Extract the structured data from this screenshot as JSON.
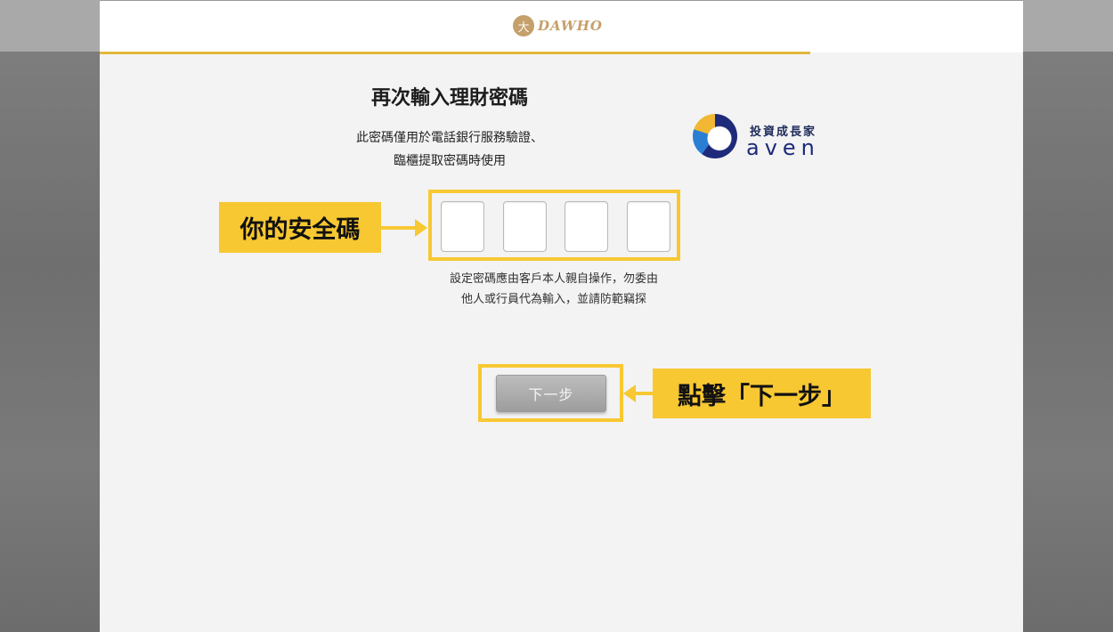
{
  "header": {
    "logo_mark": "大",
    "logo_text": "DAWHO"
  },
  "title": "再次輸入理財密碼",
  "subtitle": [
    "此密碼僅用於電話銀行服務驗證、",
    "臨櫃提取密碼時使用"
  ],
  "brand": {
    "tagline": "投資成長家",
    "name": "aven"
  },
  "pin": {
    "digits": [
      "",
      "",
      "",
      ""
    ]
  },
  "note": [
    "設定密碼應由客戶本人親自操作，勿委由",
    "他人或行員代為輸入，並請防範竊探"
  ],
  "annotations": {
    "pin_callout": "你的安全碼",
    "next_callout": "點擊「下一步」"
  },
  "next_button_label": "下一步",
  "colors": {
    "accent_yellow": "#f7c832",
    "header_gold": "#e2b93b",
    "logo_gold": "#c5a06b",
    "brand_navy": "#1e2a7a"
  }
}
